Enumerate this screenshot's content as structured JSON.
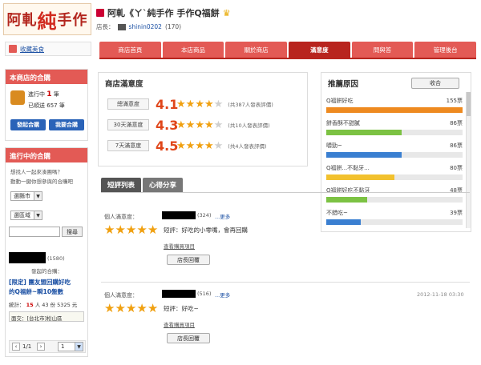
{
  "logo": {
    "big": "純",
    "left": "阿軋",
    "right": "手作"
  },
  "header": {
    "title": "阿軋《ㄚˋ純手作 手作Q福餅",
    "owner_label": "店長：",
    "owner_name": "shinin0202",
    "owner_score": "(170)"
  },
  "tabs": [
    "商店首頁",
    "本店商品",
    "關於商店",
    "滿意度",
    "問與答",
    "管理後台"
  ],
  "favorite_label": "收藏美食",
  "left_box1": {
    "header": "本商店的合購",
    "ongoing_label": "進行中",
    "ongoing_count": "1",
    "ongoing_unit": "筆",
    "done_label": "已順送",
    "done_count": "657",
    "done_unit": "筆",
    "btn_start": "發起合購",
    "btn_find": "我要合購"
  },
  "left_box2": {
    "header": "進行中的合購",
    "intro1": "想找人一起來湊團嗎？",
    "intro2": "動動一鍵你想參與的合購吧",
    "select_city": "選縣市",
    "select_district": "選區域",
    "search_btn": "搜尋",
    "item_score": "(1580)",
    "item_action": "發起的合購：",
    "item_title_1": "[限定] 團友盟回購好吃",
    "item_title_2": "的Q福餅~瞬10盤數",
    "item_stats_label": "統計：",
    "item_stats_people": "15",
    "item_stats_rest": "人 43 份 5325 元",
    "item_location": "面交：[台北市]松山區",
    "pager_text": "1/1",
    "pager_select": "1"
  },
  "satisfaction": {
    "title": "商店滿意度",
    "rows": [
      {
        "label": "總滿意度",
        "score": "4.1",
        "stars": 4,
        "count": "(共387人發表評價)"
      },
      {
        "label": "30天滿意度",
        "score": "4.3",
        "stars": 4,
        "count": "(共10人發表評價)"
      },
      {
        "label": "7天滿意度",
        "score": "4.5",
        "stars": 4,
        "count": "(共4人發表評價)"
      }
    ]
  },
  "reasons": {
    "title": "推薦原因",
    "btn": "收合",
    "items": [
      {
        "label": "Q福餅好吃",
        "count": "155票",
        "fill": 1.0,
        "color": "#ee8a20"
      },
      {
        "label": "餅香酥不甜膩",
        "count": "86票",
        "fill": 0.55,
        "color": "#7cc243"
      },
      {
        "label": "嚼勁~",
        "count": "86票",
        "fill": 0.55,
        "color": "#3a7fd1"
      },
      {
        "label": "Q福餅...不黏牙...",
        "count": "80票",
        "fill": 0.5,
        "color": "#f2c12e"
      },
      {
        "label": "Q福餅好吃不黏牙",
        "count": "48票",
        "fill": 0.3,
        "color": "#7cc243"
      },
      {
        "label": "不錯吃~",
        "count": "39票",
        "fill": 0.25,
        "color": "#3a7fd1"
      }
    ]
  },
  "review_tabs": [
    "短評列表",
    "心得分享"
  ],
  "reviews": [
    {
      "rating_label": "個人滿意度：",
      "score": "(324)",
      "more": "...更多",
      "comment_label": "短評：",
      "comment": "好吃的小零嘴，會再回購",
      "view_item": "查看購買項目",
      "reply_btn": "店長回覆",
      "date": ""
    },
    {
      "rating_label": "個人滿意度：",
      "score": "(516)",
      "more": "...更多",
      "comment_label": "短評：",
      "comment": "好吃~",
      "view_item": "查看購買項目",
      "reply_btn": "店長回覆",
      "date": "2012-11-18 03:30"
    }
  ],
  "colors": {
    "accent": "#e35a55",
    "accent_dark": "#b8241e",
    "link": "#1a4fa3",
    "star": "#f0a010"
  }
}
